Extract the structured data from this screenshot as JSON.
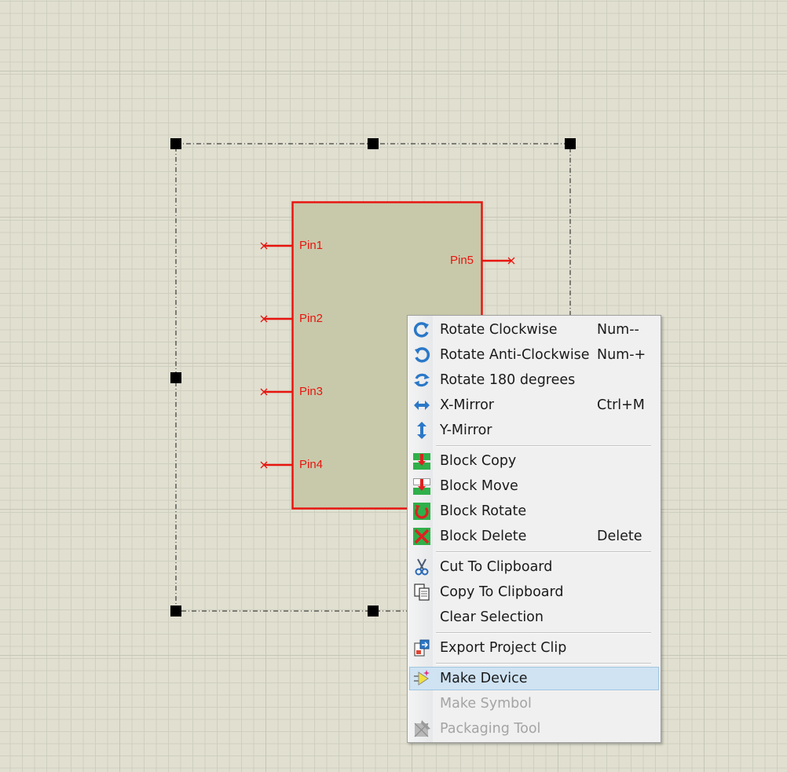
{
  "schematic": {
    "pins": [
      {
        "label": "Pin1"
      },
      {
        "label": "Pin2"
      },
      {
        "label": "Pin3"
      },
      {
        "label": "Pin4"
      },
      {
        "label": "Pin5"
      }
    ],
    "colors": {
      "wire": "#e8150f",
      "body_fill": "#c8c9aa",
      "grid_background": "#e0dfd0"
    }
  },
  "context_menu": {
    "items": [
      {
        "label": "Rotate Clockwise",
        "shortcut": "Num--",
        "icon": "rotate-clockwise-icon"
      },
      {
        "label": "Rotate Anti-Clockwise",
        "shortcut": "Num-+",
        "icon": "rotate-anticlockwise-icon"
      },
      {
        "label": "Rotate 180 degrees",
        "shortcut": "",
        "icon": "rotate-180-icon"
      },
      {
        "label": "X-Mirror",
        "shortcut": "Ctrl+M",
        "icon": "x-mirror-icon"
      },
      {
        "label": "Y-Mirror",
        "shortcut": "",
        "icon": "y-mirror-icon"
      },
      {
        "label": "Block Copy",
        "shortcut": "",
        "icon": "block-copy-icon"
      },
      {
        "label": "Block Move",
        "shortcut": "",
        "icon": "block-move-icon"
      },
      {
        "label": "Block Rotate",
        "shortcut": "",
        "icon": "block-rotate-icon"
      },
      {
        "label": "Block Delete",
        "shortcut": "Delete",
        "icon": "block-delete-icon"
      },
      {
        "label": "Cut To Clipboard",
        "shortcut": "",
        "icon": "scissors-icon"
      },
      {
        "label": "Copy To Clipboard",
        "shortcut": "",
        "icon": "copy-icon"
      },
      {
        "label": "Clear Selection",
        "shortcut": "",
        "icon": ""
      },
      {
        "label": "Export Project Clip",
        "shortcut": "",
        "icon": "export-clip-icon"
      },
      {
        "label": "Make Device",
        "shortcut": "",
        "icon": "make-device-icon",
        "selected": true
      },
      {
        "label": "Make Symbol",
        "shortcut": "",
        "icon": "",
        "disabled": true
      },
      {
        "label": "Packaging Tool",
        "shortcut": "",
        "icon": "packaging-tool-icon",
        "disabled": true
      }
    ]
  }
}
